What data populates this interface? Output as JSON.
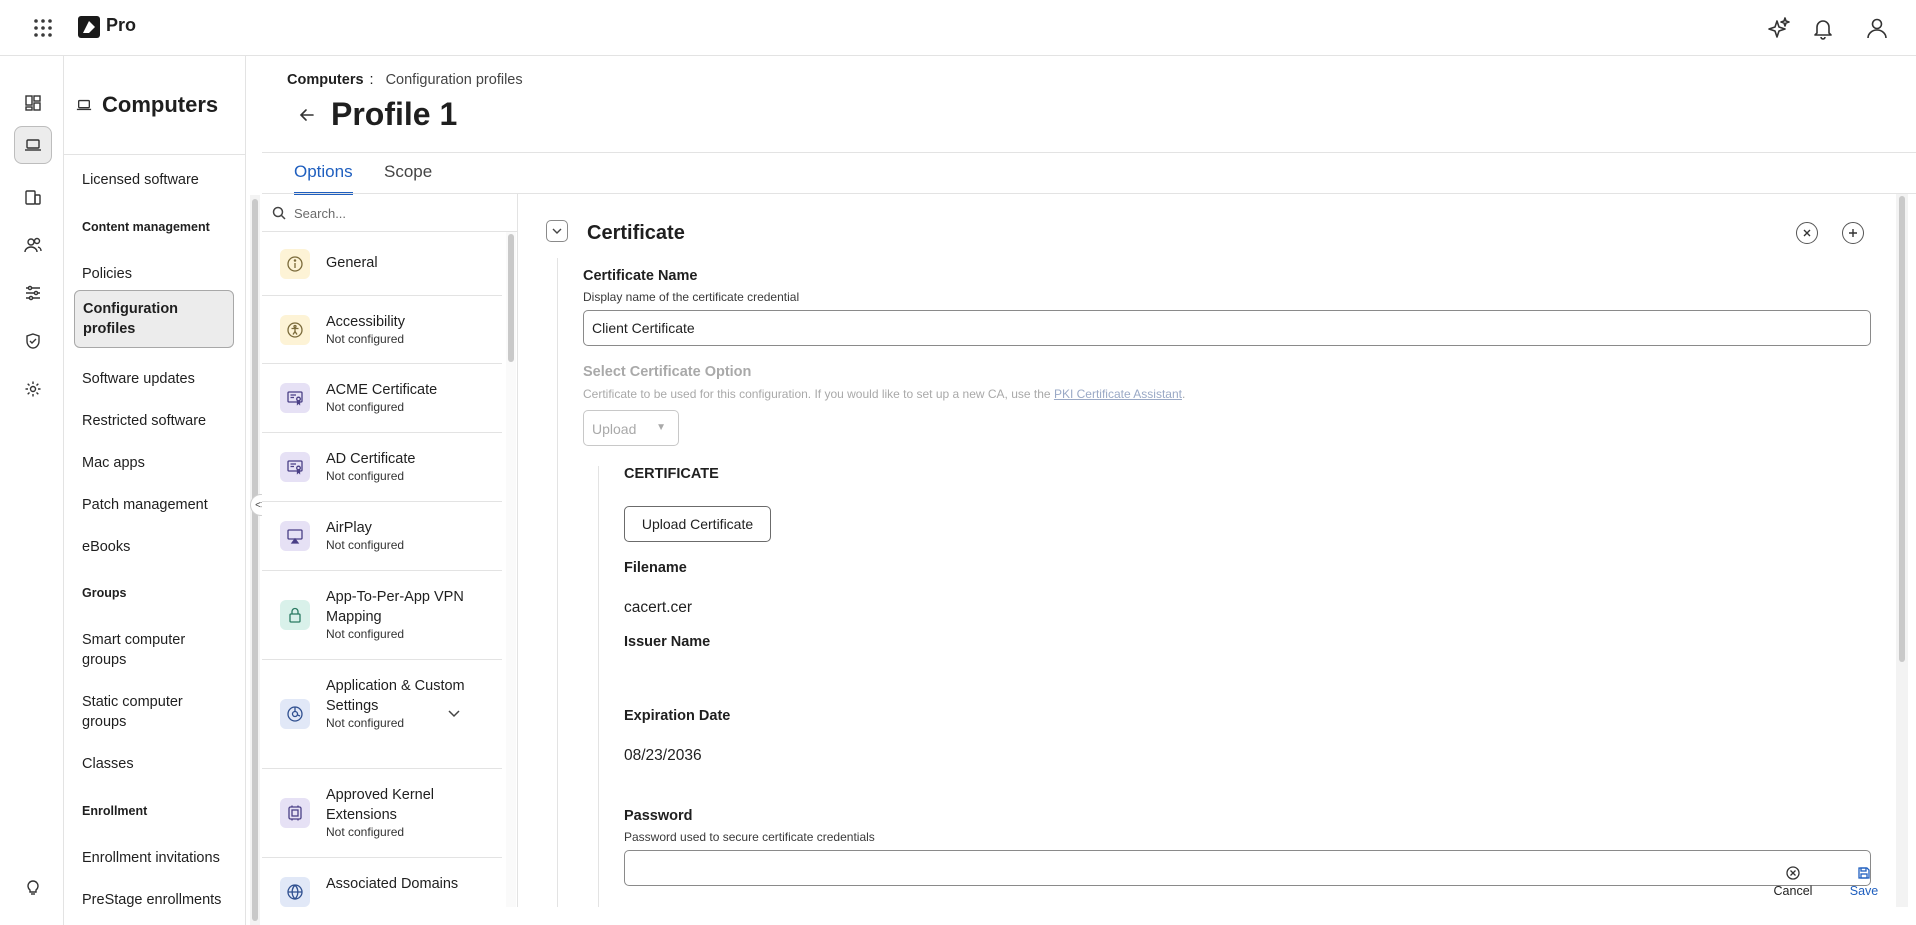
{
  "app": {
    "brand": "Pro"
  },
  "section": {
    "title": "Computers"
  },
  "sidebar": {
    "licensed_software": "Licensed software",
    "content_management": "Content management",
    "policies": "Policies",
    "configuration_profiles": "Configuration profiles",
    "software_updates": "Software updates",
    "restricted_software": "Restricted software",
    "mac_apps": "Mac apps",
    "patch_management": "Patch management",
    "ebooks": "eBooks",
    "groups": "Groups",
    "smart_computer_groups": "Smart computer groups",
    "static_computer_groups": "Static computer groups",
    "classes": "Classes",
    "enrollment": "Enrollment",
    "enrollment_invitations": "Enrollment invitations",
    "prestage_enrollments": "PreStage enrollments"
  },
  "breadcrumb": {
    "parent": "Computers",
    "separator": ":",
    "current": "Configuration profiles"
  },
  "page": {
    "title": "Profile 1"
  },
  "tabs": {
    "options": "Options",
    "scope": "Scope"
  },
  "search": {
    "placeholder": "Search..."
  },
  "payloads": {
    "general": {
      "name": "General"
    },
    "accessibility": {
      "name": "Accessibility",
      "status": "Not configured"
    },
    "acme": {
      "name": "ACME Certificate",
      "status": "Not configured"
    },
    "ad": {
      "name": "AD Certificate",
      "status": "Not configured"
    },
    "airplay": {
      "name": "AirPlay",
      "status": "Not configured"
    },
    "vpn": {
      "name": "App-To-Per-App VPN Mapping",
      "status": "Not configured"
    },
    "appcustom": {
      "name": "Application & Custom Settings",
      "status": "Not configured"
    },
    "kernel": {
      "name": "Approved Kernel Extensions",
      "status": "Not configured"
    },
    "associated": {
      "name": "Associated Domains"
    }
  },
  "certificate": {
    "title": "Certificate",
    "name_label": "Certificate Name",
    "name_desc": "Display name of the certificate credential",
    "name_value": "Client Certificate",
    "option_label": "Select Certificate Option",
    "option_desc": "Certificate to be used for this configuration. If you would like to set up a new CA, use the",
    "option_link": "PKI Certificate Assistant",
    "option_desc_end": ".",
    "option_value": "Upload",
    "section": "CERTIFICATE",
    "upload_button": "Upload Certificate",
    "filename_label": "Filename",
    "filename_value": "cacert.cer",
    "issuer_label": "Issuer Name",
    "expiration_label": "Expiration Date",
    "expiration_value": "08/23/2036",
    "password_label": "Password",
    "password_desc": "Password used to secure certificate credentials"
  },
  "footer": {
    "cancel": "Cancel",
    "save": "Save"
  },
  "colors": {
    "accent": "#1f5fbf",
    "border": "#e3e3e3",
    "disabled": "#a9a9a9",
    "icon_yellow_bg": "#fdf3d6",
    "icon_purple_bg": "#e6e1f5",
    "icon_teal_bg": "#d9f1ea",
    "icon_blue_bg": "#e1e8f7"
  },
  "icons": [
    "apps-grid-icon",
    "logo-icon",
    "sparkle-icon",
    "bell-icon",
    "user-icon",
    "dashboard-icon",
    "laptop-icon",
    "devices-icon",
    "users-icon",
    "sliders-icon",
    "shield-icon",
    "gear-icon",
    "lightbulb-icon"
  ]
}
